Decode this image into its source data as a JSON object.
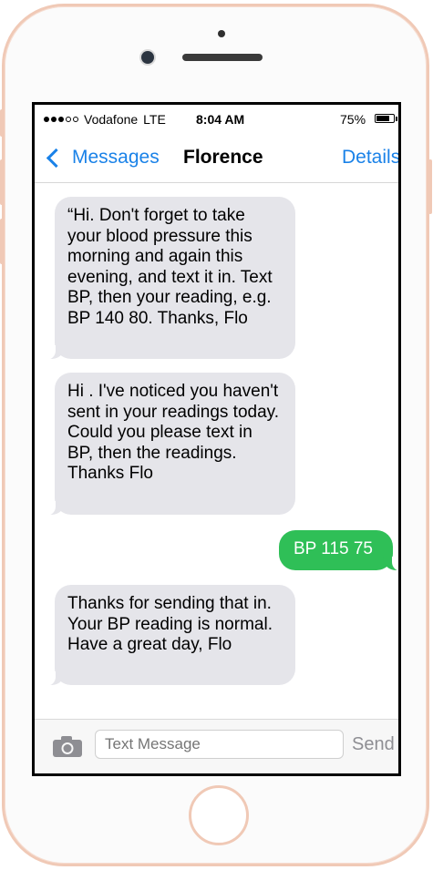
{
  "status_bar": {
    "carrier": "Vodafone",
    "network": "LTE",
    "time": "8:04 AM",
    "battery_percent": "75%",
    "battery_level": 0.75,
    "signal_bars_filled": 3,
    "signal_bars_total": 5
  },
  "nav": {
    "back_label": "Messages",
    "title": "Florence",
    "details_label": "Details"
  },
  "messages": [
    {
      "direction": "incoming",
      "text": "“Hi. Don't forget to take your blood pressure this morning and again this evening, and text it in. Text BP, then your reading, e.g. BP 140 80. Thanks, Flo"
    },
    {
      "direction": "incoming",
      "text": "Hi . I've noticed you haven't sent in your readings today. Could you please text in BP, then the readings. Thanks Flo"
    },
    {
      "direction": "outgoing",
      "text": "BP 115 75"
    },
    {
      "direction": "incoming",
      "text": "Thanks for sending that in. Your BP reading is normal. Have a great day, Flo"
    }
  ],
  "compose": {
    "placeholder": "Text Message",
    "send_label": "Send",
    "camera_icon": "camera-icon"
  },
  "colors": {
    "accent_blue": "#1a82e8",
    "incoming_bubble": "#e5e5ea",
    "outgoing_bubble": "#2fbf57",
    "phone_frame": "#f0c9b6"
  }
}
